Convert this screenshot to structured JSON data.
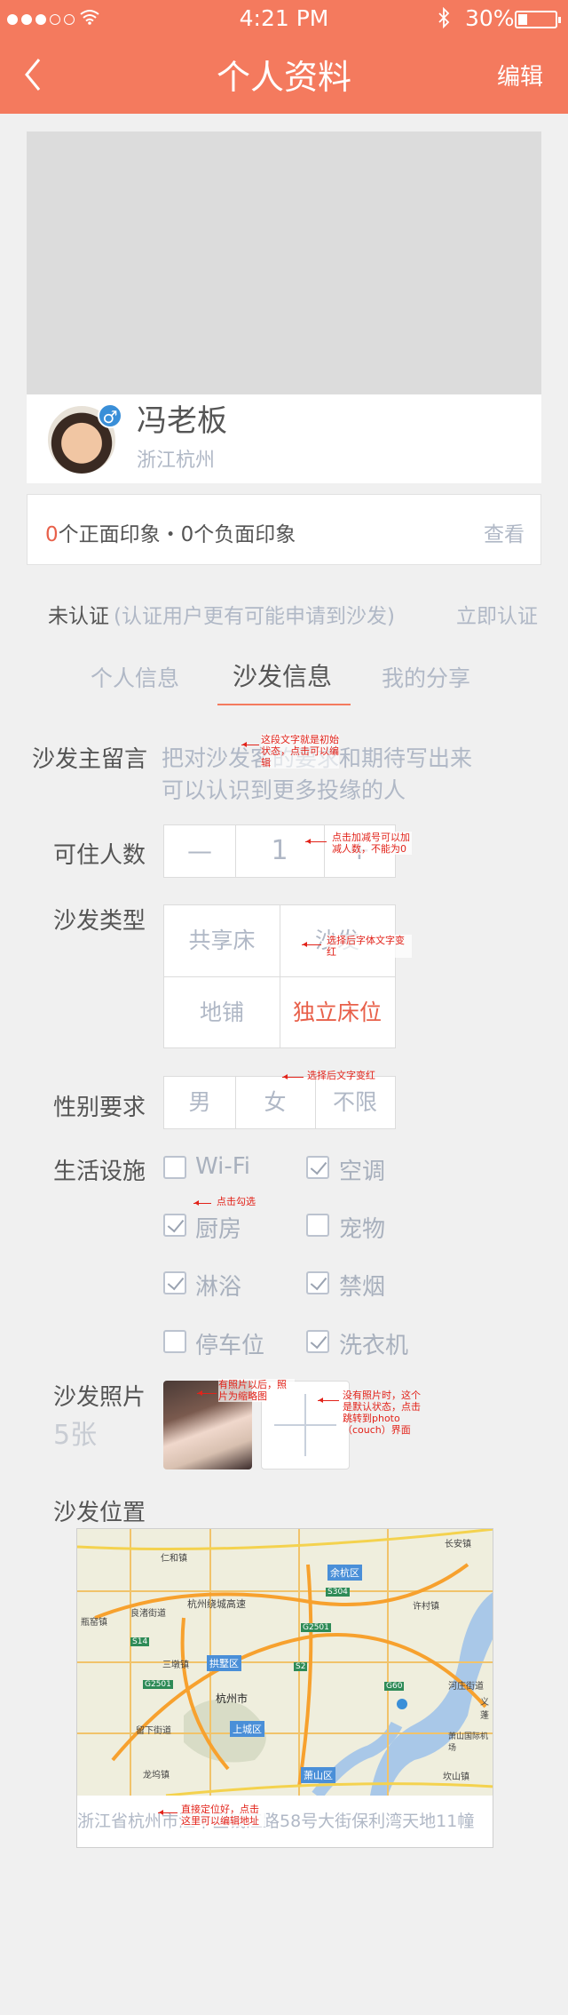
{
  "status_bar": {
    "time": "4:21 PM",
    "battery": "30%"
  },
  "nav": {
    "title": "个人资料",
    "edit": "编辑"
  },
  "profile": {
    "name": "冯老板",
    "location": "浙江杭州"
  },
  "impressions": {
    "positive_count": "0",
    "positive_rest": "个正面印象・",
    "negative": "0个负面印象",
    "view": "查看"
  },
  "verify": {
    "status": "未认证",
    "hint": "(认证用户更有可能申请到沙发)",
    "action": "立即认证"
  },
  "tabs": {
    "personal": "个人信息",
    "sofa": "沙发信息",
    "share": "我的分享"
  },
  "form": {
    "message_label": "沙发主留言",
    "message_line1": "把对沙发客的要求和期待写出来",
    "message_line2": "可以认识到更多投缘的人",
    "guests_label": "可住人数",
    "guests_minus": "—",
    "guests_value": "1",
    "guests_plus": "+",
    "type_label": "沙发类型",
    "types": [
      "共享床",
      "沙发",
      "地铺",
      "独立床位"
    ],
    "gender_label": "性别要求",
    "genders": [
      "男",
      "女",
      "不限"
    ],
    "facilities_label": "生活设施",
    "facilities": [
      {
        "name": "Wi-Fi",
        "checked": false
      },
      {
        "name": "空调",
        "checked": true
      },
      {
        "name": "厨房",
        "checked": true
      },
      {
        "name": "宠物",
        "checked": false
      },
      {
        "name": "淋浴",
        "checked": true
      },
      {
        "name": "禁烟",
        "checked": true
      },
      {
        "name": "停车位",
        "checked": false
      },
      {
        "name": "洗衣机",
        "checked": true
      }
    ],
    "photos_label": "沙发照片",
    "photos_count": "5张",
    "location_label": "沙发位置",
    "address": "浙江省杭州市江干区钱江路58号大街保利湾天地11幢"
  },
  "annotations": {
    "message": "这段文字就是初始状态，点击可以编辑",
    "guests": "点击加减号可以加减人数，不能为0",
    "type": "选择后字体文字变红",
    "gender": "选择后文字变红",
    "facility": "点击勾选",
    "photo_after": "有照片以后，照片为缩略图",
    "photo_none": "没有照片时，这个是默认状态，点击跳转到photo（couch）界面",
    "map": "直接定位好，点击这里可以编辑地址"
  },
  "map_labels": [
    "仁和镇",
    "余杭区",
    "杭州绕城高速",
    "良渚街道",
    "瓶窑镇",
    "S304",
    "G2501",
    "许村镇",
    "长安镇",
    "拱墅区",
    "三墩镇",
    "S14",
    "G2501",
    "S2",
    "杭州市",
    "上城区",
    "留下街道",
    "G60",
    "河庄街道",
    "义蓬",
    "萧山国际机场",
    "龙坞镇",
    "萧山区",
    "坎山镇"
  ],
  "colors": {
    "accent": "#f47a5e",
    "active_text": "#e8604a",
    "annotation": "#e2231a"
  }
}
